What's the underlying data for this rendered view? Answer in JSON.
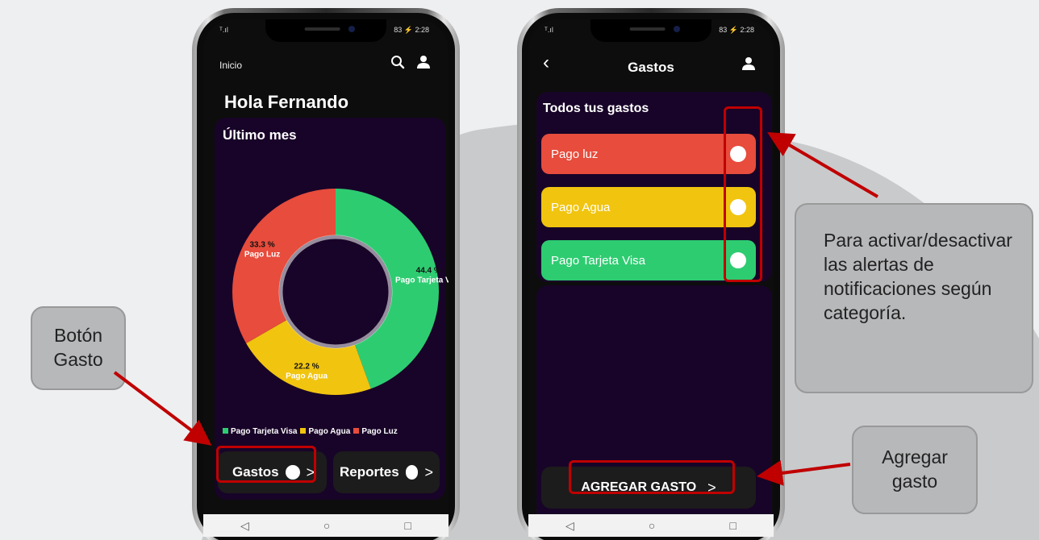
{
  "phone1": {
    "status_left": "ᵀ.ıl",
    "status_right": "83 ⚡ 2:28",
    "header_label": "Inicio",
    "greeting": "Hola Fernando",
    "card_title": "Último mes",
    "legend": [
      {
        "label": "Pago Tarjeta Visa",
        "color": "#2ecc71"
      },
      {
        "label": "Pago Agua",
        "color": "#f1c40f"
      },
      {
        "label": "Pago Luz",
        "color": "#e74c3c"
      }
    ],
    "buttons": {
      "gastos": "Gastos",
      "reportes": "Reportes"
    }
  },
  "chart_data": {
    "type": "pie",
    "categories": [
      "Pago Tarjeta Visa",
      "Pago Agua",
      "Pago Luz"
    ],
    "values": [
      44.4,
      22.2,
      33.3
    ],
    "labels": [
      "44.4 %",
      "22.2 %",
      "33.3 %"
    ],
    "colors": [
      "#2ecc71",
      "#f1c40f",
      "#e74c3c"
    ],
    "title": "Último mes",
    "legend": "bottom"
  },
  "phone2": {
    "status_left": "ᵀ.ıl",
    "status_right": "83 ⚡ 2:28",
    "back": "‹",
    "title": "Gastos",
    "card_title": "Todos tus gastos",
    "expenses": [
      {
        "label": "Pago luz",
        "color": "#e74c3c"
      },
      {
        "label": "Pago Agua",
        "color": "#f1c40f"
      },
      {
        "label": "Pago Tarjeta Visa",
        "color": "#2ecc71"
      }
    ],
    "add_button": "AGREGAR GASTO"
  },
  "callouts": {
    "boton_gasto": "Botón Gasto",
    "alertas": "Para activar/desactivar las alertas de notificaciones según categoría.",
    "agregar": "Agregar gasto"
  },
  "nav": {
    "back": "◁",
    "home": "○",
    "recent": "□"
  },
  "colors": {
    "card": "#180428",
    "highlight": "#c00000",
    "callout": "#b7b8ba"
  }
}
